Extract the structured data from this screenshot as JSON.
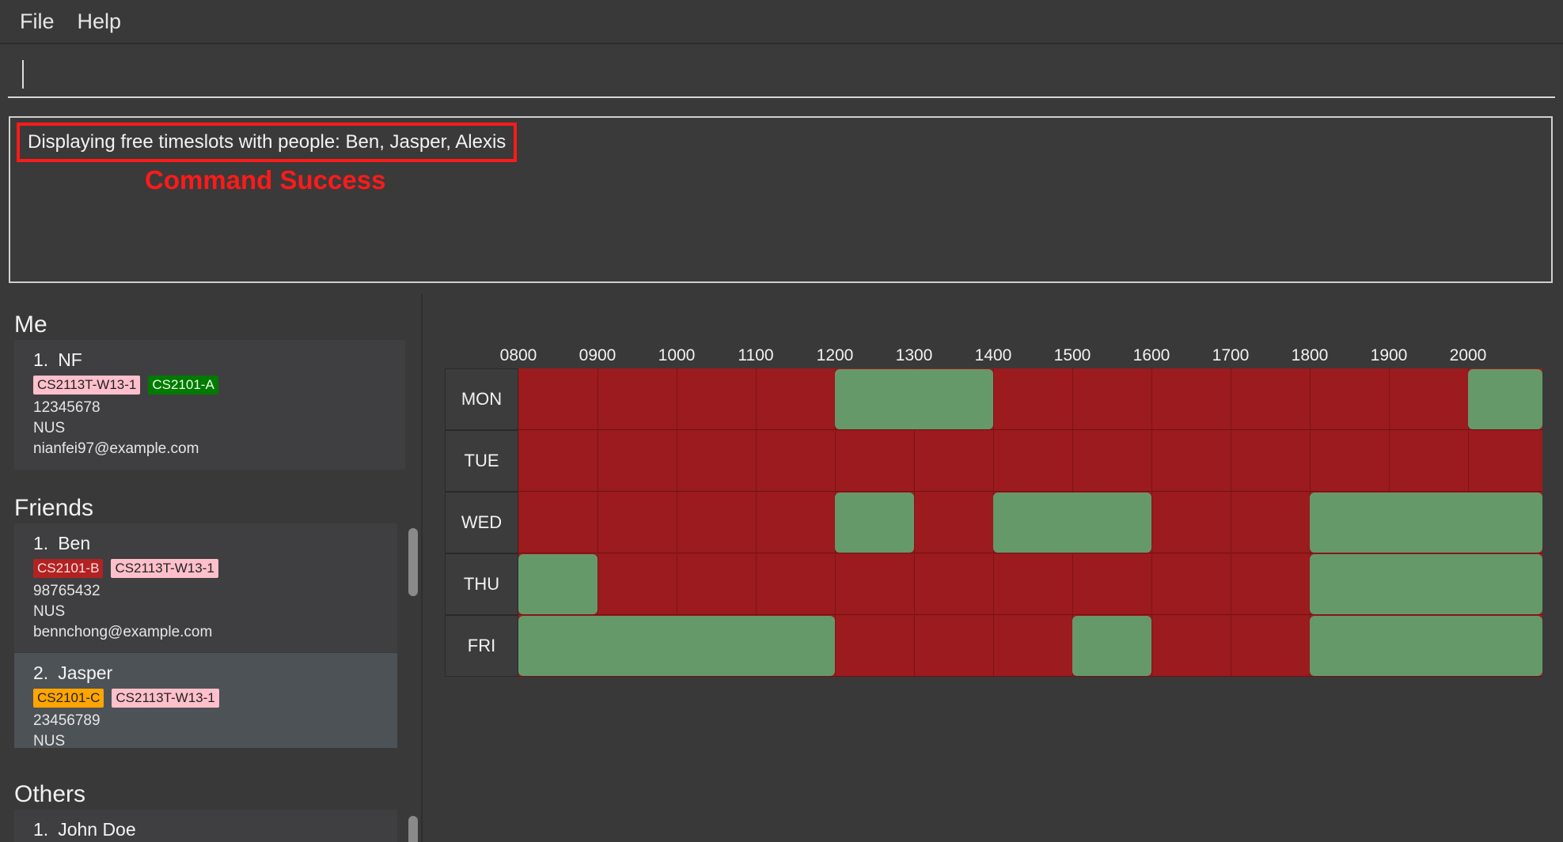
{
  "menu": {
    "file": "File",
    "help": "Help"
  },
  "command": {
    "value": "",
    "placeholder": ""
  },
  "result": {
    "message": "Displaying free timeslots with people: Ben, Jasper, Alexis",
    "annotation": "Command Success"
  },
  "sections": {
    "me": "Me",
    "friends": "Friends",
    "others": "Others"
  },
  "me": {
    "index": "1.",
    "name": "NF",
    "tags": [
      "CS2113T-W13-1",
      "CS2101-A"
    ],
    "phone": "12345678",
    "address": "NUS",
    "email": "nianfei97@example.com"
  },
  "friends": [
    {
      "index": "1.",
      "name": "Ben",
      "tags": [
        "CS2101-B",
        "CS2113T-W13-1"
      ],
      "phone": "98765432",
      "address": "NUS",
      "email": "bennchong@example.com"
    },
    {
      "index": "2.",
      "name": "Jasper",
      "tags": [
        "CS2101-C",
        "CS2113T-W13-1"
      ],
      "phone": "23456789",
      "address": "NUS"
    }
  ],
  "others": [
    {
      "index": "1.",
      "name": "John Doe"
    }
  ],
  "timetable": {
    "hours": [
      "0800",
      "0900",
      "1000",
      "1100",
      "1200",
      "1300",
      "1400",
      "1500",
      "1600",
      "1700",
      "1800",
      "1900",
      "2000"
    ],
    "days": [
      "MON",
      "TUE",
      "WED",
      "THU",
      "FRI"
    ],
    "free": {
      "MON": [
        [
          4,
          6
        ],
        [
          12,
          13
        ]
      ],
      "TUE": [],
      "WED": [
        [
          4,
          5
        ],
        [
          6,
          8
        ],
        [
          10,
          13
        ]
      ],
      "THU": [
        [
          0,
          1
        ],
        [
          10,
          13
        ]
      ],
      "FRI": [
        [
          0,
          4
        ],
        [
          7,
          8
        ],
        [
          10,
          13
        ]
      ]
    }
  },
  "colors": {
    "busy": "#9b1b1e",
    "free": "#66996a",
    "highlight": "#ff1a1a"
  }
}
